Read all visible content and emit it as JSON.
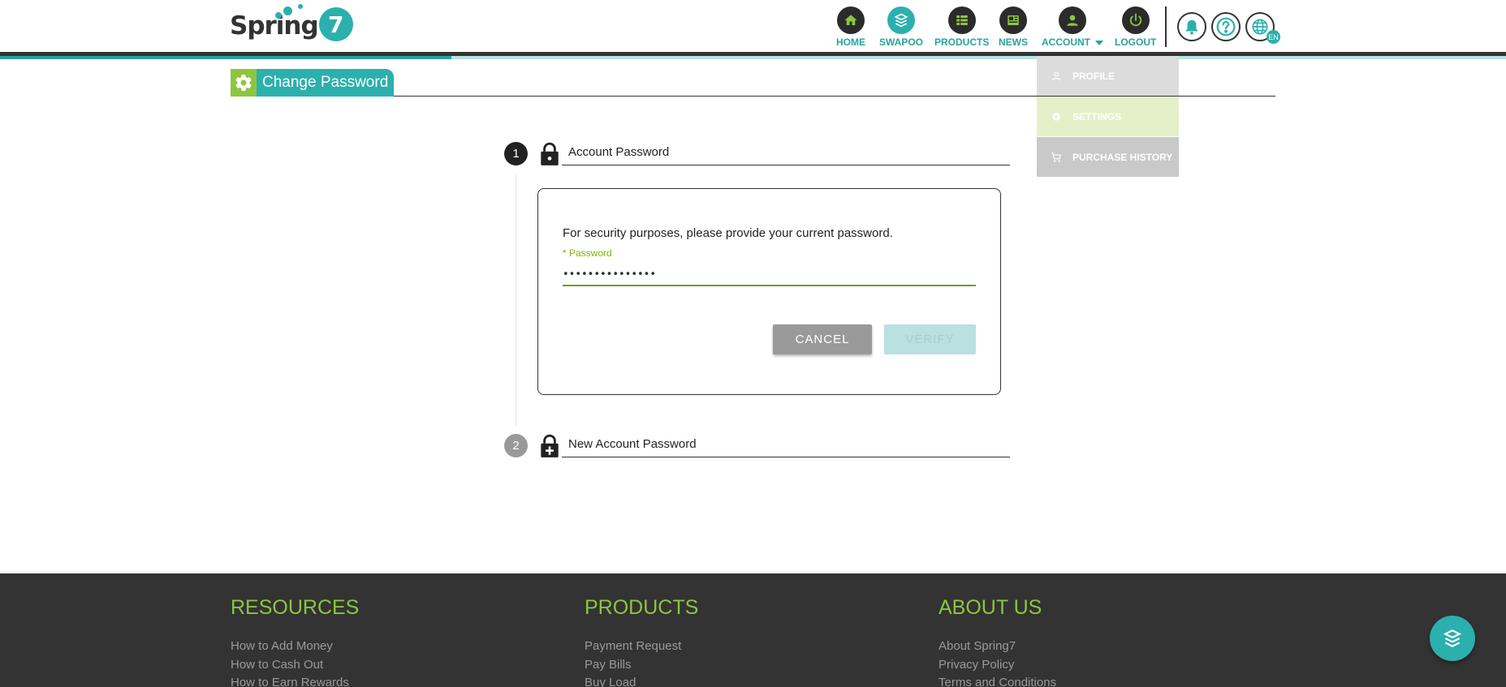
{
  "logo": {
    "text": "Spring",
    "number": "7"
  },
  "nav": {
    "items": [
      {
        "label": "HOME",
        "icon": "home-icon"
      },
      {
        "label": "SWAPOO",
        "icon": "swapoo-icon"
      },
      {
        "label": "PRODUCTS",
        "icon": "products-icon"
      },
      {
        "label": "NEWS",
        "icon": "news-icon"
      },
      {
        "label": "ACCOUNT",
        "icon": "person-icon"
      },
      {
        "label": "LOGOUT",
        "icon": "power-icon"
      }
    ],
    "language_badge": "EN"
  },
  "account_menu": {
    "items": [
      {
        "label": "PROFILE",
        "icon": "person-icon"
      },
      {
        "label": "SETTINGS",
        "icon": "gear-icon"
      },
      {
        "label": "PURCHASE HISTORY",
        "icon": "cart-icon"
      }
    ]
  },
  "page": {
    "title": "Change Password"
  },
  "steps": [
    {
      "number": "1",
      "title": "Account Password"
    },
    {
      "number": "2",
      "title": "New Account Password"
    }
  ],
  "verify_card": {
    "message": "For security purposes, please provide your current password.",
    "password_label": "* Password",
    "password_value": "•••••••••••••••",
    "cancel_label": "CANCEL",
    "verify_label": "VERIFY"
  },
  "footer": {
    "columns": [
      {
        "heading": "RESOURCES",
        "links": [
          "How to Add Money",
          "How to Cash Out",
          "How to Earn Rewards"
        ]
      },
      {
        "heading": "PRODUCTS",
        "links": [
          "Payment Request",
          "Pay Bills",
          "Buy Load"
        ]
      },
      {
        "heading": "ABOUT US",
        "links": [
          "About Spring7",
          "Privacy Policy",
          "Terms and Conditions"
        ]
      }
    ]
  },
  "colors": {
    "brand_teal": "#2bb0ad",
    "brand_green": "#8cc63f",
    "dark": "#333333"
  }
}
